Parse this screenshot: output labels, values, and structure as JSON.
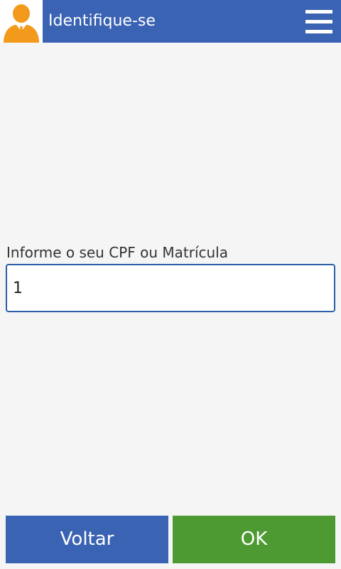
{
  "header": {
    "title": "Identifique-se",
    "avatar_icon": "user-avatar-icon",
    "menu_icon": "hamburger-menu-icon"
  },
  "form": {
    "label": "Informe o seu CPF ou Matrícula",
    "value": "1"
  },
  "footer": {
    "back_label": "Voltar",
    "ok_label": "OK"
  },
  "colors": {
    "header_bg": "#3a63b3",
    "avatar_orange": "#f39a1c",
    "ok_green": "#4e9a32",
    "input_border": "#2a5ea8",
    "background": "#f5f5f5"
  }
}
